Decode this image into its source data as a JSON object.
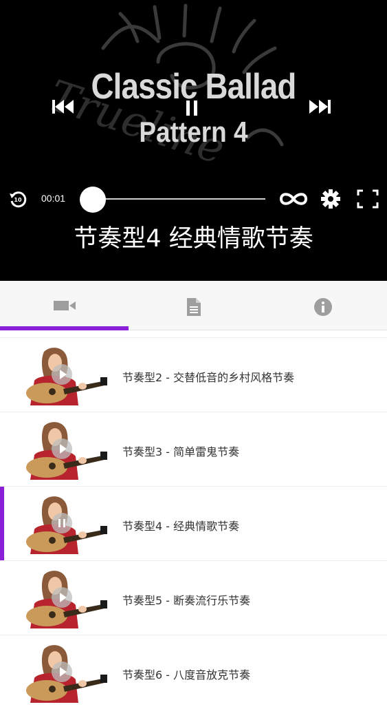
{
  "player": {
    "watermark_text": "Trueline",
    "title_line1": "Classic Ballad",
    "title_line2": "Pattern 4",
    "current_time": "00:01",
    "progress_fraction": 0.0,
    "subtitle": "节奏型4 经典情歌节奏",
    "replay_seconds": "10"
  },
  "tabs": [
    {
      "name": "video",
      "icon": "video-camera-icon",
      "selected": true
    },
    {
      "name": "notes",
      "icon": "document-icon",
      "selected": false
    },
    {
      "name": "info",
      "icon": "info-icon",
      "selected": false
    }
  ],
  "lessons": [
    {
      "title": "节奏型2 - 交替低音的乡村风格节奏",
      "state": "play"
    },
    {
      "title": "节奏型3 - 简单雷鬼节奏",
      "state": "play"
    },
    {
      "title": "节奏型4 - 经典情歌节奏",
      "state": "pause"
    },
    {
      "title": "节奏型5 - 断奏流行乐节奏",
      "state": "play"
    },
    {
      "title": "节奏型6 - 八度音放克节奏",
      "state": "play"
    }
  ],
  "colors": {
    "accent": "#8a1ed9",
    "player_bg": "#000000",
    "tab_icon": "#9e9e9e"
  }
}
